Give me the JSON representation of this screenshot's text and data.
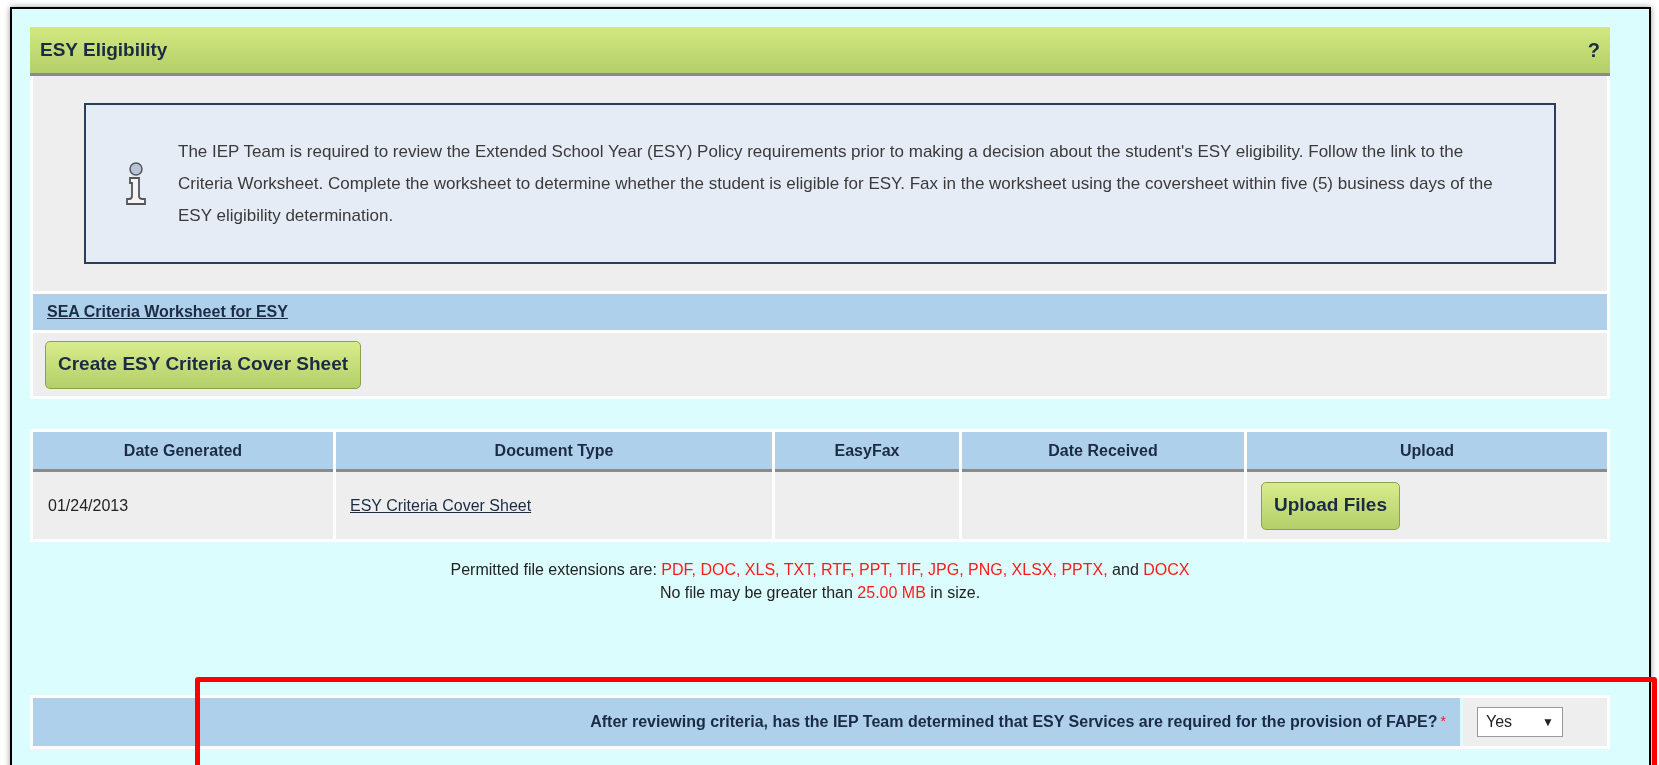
{
  "panel": {
    "title": "ESY Eligibility",
    "help": "?"
  },
  "info": {
    "text": "The IEP Team is required to review the Extended School Year (ESY) Policy requirements prior to making a decision about the student's ESY eligibility. Follow the link to the Criteria Worksheet. Complete the worksheet to determine whether the student is eligible for ESY. Fax in the worksheet using the coversheet within five (5) business days of the ESY eligibility determination."
  },
  "worksheet_link": "SEA Criteria Worksheet for ESY",
  "create_button": "Create ESY Criteria Cover Sheet",
  "table": {
    "columns": [
      "Date Generated",
      "Document Type",
      "EasyFax",
      "Date Received",
      "Upload"
    ],
    "rows": [
      {
        "date_generated": "01/24/2013",
        "document_type": "ESY Criteria Cover Sheet",
        "upload_button": "Upload Files"
      }
    ]
  },
  "notes": [
    [
      {
        "text": "Permitted file extensions are: ",
        "highlight": false
      },
      {
        "text": "PDF, DOC, XLS, TXT, RTF, PPT, TIF, JPG, PNG, XLSX, PPTX,",
        "highlight": true
      },
      {
        "text": " and ",
        "highlight": false
      },
      {
        "text": "DOCX",
        "highlight": true
      }
    ],
    [
      {
        "text": "No file may be greater than ",
        "highlight": false
      },
      {
        "text": "25.00 MB",
        "highlight": true
      },
      {
        "text": " in size.",
        "highlight": false
      }
    ]
  ],
  "question": {
    "label": "After reviewing criteria, has the IEP Team determined that ESY Services are required for the provision of FAPE?",
    "required": true,
    "required_mark": "*",
    "value": "Yes",
    "caret": "▼"
  }
}
